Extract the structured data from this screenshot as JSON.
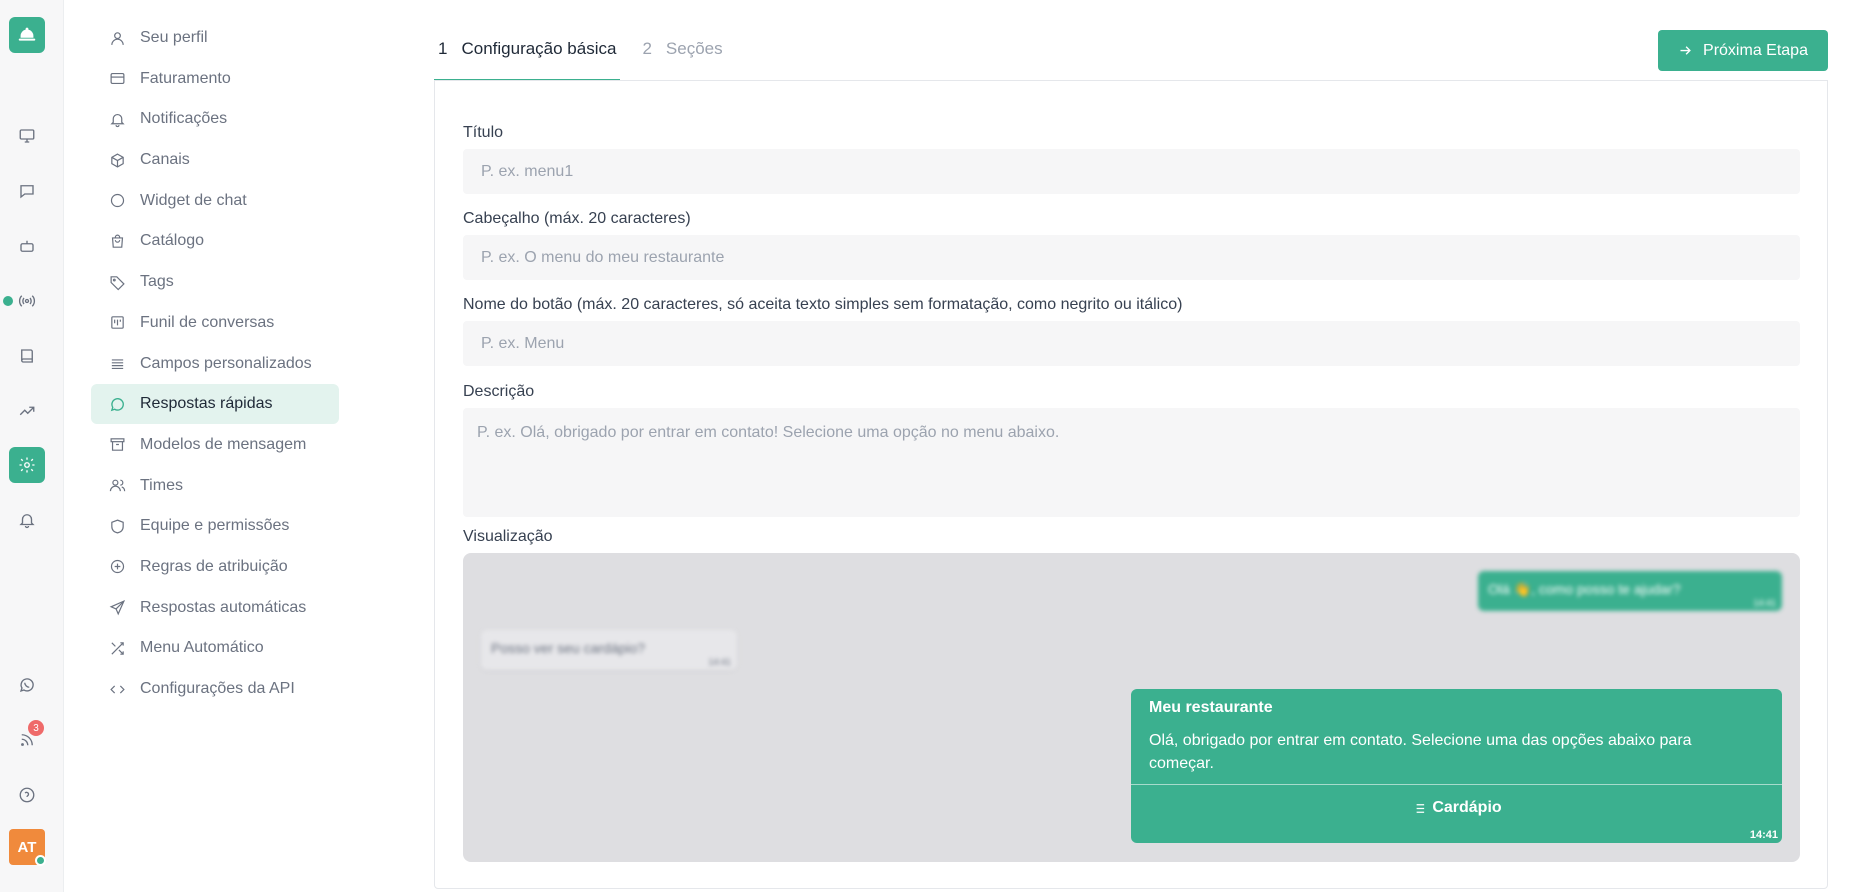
{
  "rail": {
    "badge_count": "3",
    "avatar_initials": "AT",
    "icons": [
      "bell-logo-icon",
      "monitor-icon",
      "chat-icon",
      "bot-icon",
      "broadcast-icon",
      "book-icon",
      "trending-icon",
      "settings-icon",
      "bell-icon",
      "whatsapp-icon",
      "rss-icon",
      "help-icon"
    ],
    "accent_color": "#3bb08f"
  },
  "nav": {
    "items": [
      {
        "label": "Seu perfil",
        "icon": "user-icon"
      },
      {
        "label": "Faturamento",
        "icon": "credit-card-icon"
      },
      {
        "label": "Notificações",
        "icon": "bell-icon"
      },
      {
        "label": "Canais",
        "icon": "box-icon"
      },
      {
        "label": "Widget de chat",
        "icon": "circle-icon"
      },
      {
        "label": "Catálogo",
        "icon": "shopping-bag-icon"
      },
      {
        "label": "Tags",
        "icon": "tag-icon"
      },
      {
        "label": "Funil de conversas",
        "icon": "kanban-icon"
      },
      {
        "label": "Campos personalizados",
        "icon": "list-icon"
      },
      {
        "label": "Respostas rápidas",
        "icon": "message-circle-icon"
      },
      {
        "label": "Modelos de mensagem",
        "icon": "archive-icon"
      },
      {
        "label": "Times",
        "icon": "users-icon"
      },
      {
        "label": "Equipe e permissões",
        "icon": "shield-icon"
      },
      {
        "label": "Regras de atribuição",
        "icon": "plus-circle-icon"
      },
      {
        "label": "Respostas automáticas",
        "icon": "send-icon"
      },
      {
        "label": "Menu Automático",
        "icon": "shuffle-icon"
      },
      {
        "label": "Configurações da API",
        "icon": "code-icon"
      }
    ],
    "active_index": 9
  },
  "tabs": [
    {
      "num": "1",
      "label": "Configuração básica"
    },
    {
      "num": "2",
      "label": "Seções"
    }
  ],
  "next_button": "Próxima Etapa",
  "form": {
    "title_label": "Título",
    "title_placeholder": "P. ex. menu1",
    "header_label": "Cabeçalho (máx. 20 caracteres)",
    "header_placeholder": "P. ex. O menu do meu restaurante",
    "button_label": "Nome do botão (máx. 20 caracteres, só aceita texto simples sem formatação, como negrito ou itálico)",
    "button_placeholder": "P. ex. Menu",
    "description_label": "Descrição",
    "description_placeholder": "P. ex. Olá, obrigado por entrar em contato! Selecione uma opção no menu abaixo.",
    "preview_label": "Visualização"
  },
  "preview": {
    "outgoing_text": "Olá 👋, como posso te ajudar?",
    "outgoing_time": "14:41",
    "incoming_text": "Posso ver seu cardápio?",
    "incoming_time": "14:41",
    "menu_header": "Meu restaurante",
    "menu_body": "Olá, obrigado por entrar em contato. Selecione uma das opções abaixo para começar.",
    "menu_button": "Cardápio",
    "menu_time": "14:41"
  }
}
